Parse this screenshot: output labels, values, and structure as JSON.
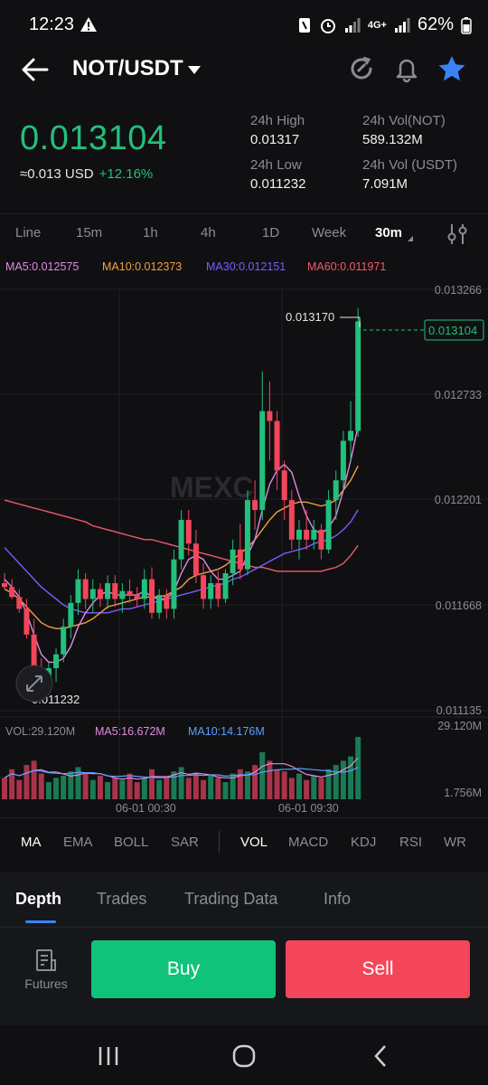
{
  "status_bar": {
    "time": "12:23",
    "battery": "62%",
    "network": "4G+"
  },
  "header": {
    "pair": "NOT/USDT"
  },
  "price": {
    "last": "0.013104",
    "approx_usd": "≈0.013 USD",
    "change": "+12.16%",
    "high_label": "24h High",
    "high_value": "0.01317",
    "low_label": "24h Low",
    "low_value": "0.011232",
    "vol_not_label": "24h Vol(NOT)",
    "vol_not_value": "589.132M",
    "vol_usdt_label": "24h Vol (USDT)",
    "vol_usdt_value": "7.091M"
  },
  "intervals": [
    "Line",
    "15m",
    "1h",
    "4h",
    "1D",
    "Week",
    "30m"
  ],
  "active_interval": "30m",
  "ma_legend": {
    "ma5": "MA5:0.012575",
    "ma10": "MA10:0.012373",
    "ma30": "MA30:0.012151",
    "ma60": "MA60:0.011971"
  },
  "chart": {
    "y_ticks": [
      "0.013266",
      "0.012733",
      "0.012201",
      "0.011668",
      "0.011135"
    ],
    "max_label": "0.013170",
    "min_label": "0.011232",
    "price_tag": "0.013104",
    "vol_label": "VOL:29.120M",
    "vol_ma5": "MA5:16.672M",
    "vol_ma10": "MA10:14.176M",
    "vol_max": "29.120M",
    "vol_min": "1.756M",
    "x_labels": [
      "06-01 00:30",
      "06-01 09:30"
    ],
    "watermark": "MEXC"
  },
  "indicators": [
    "MA",
    "EMA",
    "BOLL",
    "SAR",
    "VOL",
    "MACD",
    "KDJ",
    "RSI",
    "WR"
  ],
  "active_indicators": [
    "MA",
    "VOL"
  ],
  "lower_tabs": [
    "Depth",
    "Trades",
    "Trading Data",
    "Info"
  ],
  "active_lower_tab": "Depth",
  "actions": {
    "futures": "Futures",
    "buy": "Buy",
    "sell": "Sell"
  },
  "colors": {
    "up": "#22c07c",
    "down": "#f3465b",
    "accent": "#3b82f6",
    "ma5": "#e08ae0",
    "ma10": "#f0a040",
    "ma30": "#7b5cff",
    "ma60": "#f05a6a"
  },
  "chart_data": {
    "type": "candlestick",
    "interval": "30m",
    "y_range": [
      0.011135,
      0.013266
    ],
    "candles": [
      {
        "o": 0.01178,
        "h": 0.01183,
        "l": 0.01175,
        "c": 0.01176
      },
      {
        "o": 0.01176,
        "h": 0.0118,
        "l": 0.0117,
        "c": 0.01171
      },
      {
        "o": 0.01171,
        "h": 0.01175,
        "l": 0.01163,
        "c": 0.01165
      },
      {
        "o": 0.01165,
        "h": 0.0117,
        "l": 0.0115,
        "c": 0.01152
      },
      {
        "o": 0.01152,
        "h": 0.0116,
        "l": 0.0113,
        "c": 0.01135
      },
      {
        "o": 0.01135,
        "h": 0.0114,
        "l": 0.01123,
        "c": 0.01127
      },
      {
        "o": 0.01127,
        "h": 0.01138,
        "l": 0.01123,
        "c": 0.01135
      },
      {
        "o": 0.01135,
        "h": 0.01145,
        "l": 0.01128,
        "c": 0.01142
      },
      {
        "o": 0.01142,
        "h": 0.0116,
        "l": 0.01138,
        "c": 0.01156
      },
      {
        "o": 0.01156,
        "h": 0.01172,
        "l": 0.0115,
        "c": 0.01168
      },
      {
        "o": 0.01168,
        "h": 0.01185,
        "l": 0.01162,
        "c": 0.0118
      },
      {
        "o": 0.0118,
        "h": 0.01183,
        "l": 0.01165,
        "c": 0.0117
      },
      {
        "o": 0.0117,
        "h": 0.0118,
        "l": 0.01163,
        "c": 0.01175
      },
      {
        "o": 0.01175,
        "h": 0.01178,
        "l": 0.01166,
        "c": 0.0117
      },
      {
        "o": 0.0117,
        "h": 0.01182,
        "l": 0.01165,
        "c": 0.01178
      },
      {
        "o": 0.01178,
        "h": 0.01182,
        "l": 0.01166,
        "c": 0.0117
      },
      {
        "o": 0.0117,
        "h": 0.01178,
        "l": 0.01163,
        "c": 0.01174
      },
      {
        "o": 0.01174,
        "h": 0.0118,
        "l": 0.01168,
        "c": 0.01172
      },
      {
        "o": 0.01172,
        "h": 0.01176,
        "l": 0.01166,
        "c": 0.0117
      },
      {
        "o": 0.0117,
        "h": 0.01185,
        "l": 0.01165,
        "c": 0.0118
      },
      {
        "o": 0.0118,
        "h": 0.01186,
        "l": 0.0116,
        "c": 0.01163
      },
      {
        "o": 0.01163,
        "h": 0.01175,
        "l": 0.0116,
        "c": 0.01172
      },
      {
        "o": 0.01172,
        "h": 0.01175,
        "l": 0.0116,
        "c": 0.01165
      },
      {
        "o": 0.01165,
        "h": 0.01195,
        "l": 0.0116,
        "c": 0.0119
      },
      {
        "o": 0.0119,
        "h": 0.01215,
        "l": 0.01185,
        "c": 0.0121
      },
      {
        "o": 0.0121,
        "h": 0.01215,
        "l": 0.01192,
        "c": 0.01198
      },
      {
        "o": 0.01198,
        "h": 0.01205,
        "l": 0.01178,
        "c": 0.01182
      },
      {
        "o": 0.01182,
        "h": 0.01188,
        "l": 0.01165,
        "c": 0.0117
      },
      {
        "o": 0.0117,
        "h": 0.01182,
        "l": 0.01165,
        "c": 0.01178
      },
      {
        "o": 0.01178,
        "h": 0.01184,
        "l": 0.01166,
        "c": 0.0117
      },
      {
        "o": 0.0117,
        "h": 0.01185,
        "l": 0.01168,
        "c": 0.01183
      },
      {
        "o": 0.01183,
        "h": 0.012,
        "l": 0.01177,
        "c": 0.01195
      },
      {
        "o": 0.01195,
        "h": 0.01208,
        "l": 0.0118,
        "c": 0.01185
      },
      {
        "o": 0.01185,
        "h": 0.01225,
        "l": 0.01182,
        "c": 0.0122
      },
      {
        "o": 0.0122,
        "h": 0.0123,
        "l": 0.01205,
        "c": 0.01215
      },
      {
        "o": 0.01215,
        "h": 0.01285,
        "l": 0.0121,
        "c": 0.01265
      },
      {
        "o": 0.01265,
        "h": 0.0128,
        "l": 0.0124,
        "c": 0.0126
      },
      {
        "o": 0.0126,
        "h": 0.01265,
        "l": 0.01225,
        "c": 0.01235
      },
      {
        "o": 0.01235,
        "h": 0.0124,
        "l": 0.0121,
        "c": 0.0122
      },
      {
        "o": 0.0122,
        "h": 0.01225,
        "l": 0.01195,
        "c": 0.012
      },
      {
        "o": 0.012,
        "h": 0.0121,
        "l": 0.0119,
        "c": 0.01205
      },
      {
        "o": 0.01205,
        "h": 0.01215,
        "l": 0.01195,
        "c": 0.012
      },
      {
        "o": 0.012,
        "h": 0.0121,
        "l": 0.01195,
        "c": 0.01205
      },
      {
        "o": 0.01205,
        "h": 0.01208,
        "l": 0.0119,
        "c": 0.01195
      },
      {
        "o": 0.01195,
        "h": 0.01225,
        "l": 0.01193,
        "c": 0.0122
      },
      {
        "o": 0.0122,
        "h": 0.01235,
        "l": 0.0121,
        "c": 0.0123
      },
      {
        "o": 0.0123,
        "h": 0.01255,
        "l": 0.01225,
        "c": 0.0125
      },
      {
        "o": 0.0125,
        "h": 0.0127,
        "l": 0.0124,
        "c": 0.01255
      },
      {
        "o": 0.01255,
        "h": 0.01317,
        "l": 0.01252,
        "c": 0.013104
      }
    ],
    "ma5": [
      0.0118,
      0.01176,
      0.01171,
      0.01163,
      0.01152,
      0.01142,
      0.01138,
      0.01138,
      0.0114,
      0.01146,
      0.01156,
      0.01163,
      0.01168,
      0.01172,
      0.01174,
      0.01172,
      0.01172,
      0.01172,
      0.01172,
      0.01174,
      0.01171,
      0.0117,
      0.0117,
      0.01174,
      0.01183,
      0.0119,
      0.01192,
      0.0119,
      0.01184,
      0.0118,
      0.0118,
      0.01182,
      0.01184,
      0.01192,
      0.012,
      0.01215,
      0.01228,
      0.01235,
      0.01238,
      0.01234,
      0.01222,
      0.01212,
      0.01205,
      0.01203,
      0.01206,
      0.01212,
      0.01225,
      0.0124,
      0.012575
    ],
    "ma10": [
      0.01175,
      0.01173,
      0.0117,
      0.01166,
      0.01162,
      0.01158,
      0.01156,
      0.01155,
      0.01155,
      0.01156,
      0.01157,
      0.01158,
      0.0116,
      0.01163,
      0.01166,
      0.01167,
      0.01168,
      0.01169,
      0.0117,
      0.01171,
      0.01171,
      0.01171,
      0.01172,
      0.01174,
      0.01176,
      0.0118,
      0.01182,
      0.01183,
      0.01184,
      0.01185,
      0.01187,
      0.0119,
      0.01193,
      0.01196,
      0.012,
      0.01205,
      0.0121,
      0.01214,
      0.01216,
      0.01218,
      0.01219,
      0.01219,
      0.01218,
      0.01217,
      0.01218,
      0.0122,
      0.01225,
      0.0123,
      0.012373
    ],
    "ma30": [
      0.01196,
      0.01192,
      0.01188,
      0.01184,
      0.0118,
      0.01176,
      0.01173,
      0.0117,
      0.01167,
      0.01165,
      0.01164,
      0.01163,
      0.01163,
      0.01163,
      0.01163,
      0.01164,
      0.01165,
      0.01165,
      0.01166,
      0.01167,
      0.01168,
      0.01169,
      0.0117,
      0.01171,
      0.01172,
      0.01173,
      0.01174,
      0.01175,
      0.01176,
      0.01177,
      0.01178,
      0.0118,
      0.01181,
      0.01183,
      0.01185,
      0.01187,
      0.01189,
      0.01191,
      0.01193,
      0.01194,
      0.01195,
      0.01196,
      0.01198,
      0.01199,
      0.012,
      0.01202,
      0.01205,
      0.01209,
      0.012151
    ],
    "ma60": [
      0.0122,
      0.01219,
      0.01218,
      0.01217,
      0.01216,
      0.01215,
      0.01214,
      0.01213,
      0.01212,
      0.01211,
      0.0121,
      0.01209,
      0.01207,
      0.01206,
      0.01205,
      0.01204,
      0.01203,
      0.01202,
      0.01201,
      0.012,
      0.012,
      0.01199,
      0.01198,
      0.01197,
      0.01196,
      0.01195,
      0.01194,
      0.01193,
      0.01192,
      0.01191,
      0.0119,
      0.01189,
      0.01188,
      0.01187,
      0.01186,
      0.01186,
      0.01185,
      0.01184,
      0.01184,
      0.01184,
      0.01184,
      0.01184,
      0.01184,
      0.01184,
      0.01185,
      0.01186,
      0.01188,
      0.01192,
      0.011971
    ],
    "volume": [
      10,
      14,
      9,
      16,
      18,
      12,
      8,
      10,
      11,
      13,
      15,
      12,
      9,
      11,
      8,
      10,
      9,
      12,
      8,
      10,
      14,
      9,
      11,
      13,
      15,
      10,
      12,
      9,
      11,
      10,
      8,
      12,
      14,
      13,
      16,
      22,
      18,
      14,
      13,
      10,
      12,
      9,
      11,
      10,
      14,
      16,
      18,
      20,
      29.12
    ],
    "vol_range": [
      1.756,
      29.12
    ]
  }
}
